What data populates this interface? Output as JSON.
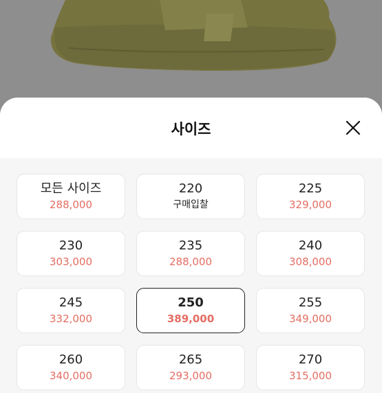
{
  "sheet": {
    "title": "사이즈"
  },
  "sizes": [
    {
      "label": "모든 사이즈",
      "price": "288,000"
    },
    {
      "label": "220",
      "price": "구매입찰"
    },
    {
      "label": "225",
      "price": "329,000"
    },
    {
      "label": "230",
      "price": "303,000"
    },
    {
      "label": "235",
      "price": "288,000"
    },
    {
      "label": "240",
      "price": "308,000"
    },
    {
      "label": "245",
      "price": "332,000"
    },
    {
      "label": "250",
      "price": "389,000"
    },
    {
      "label": "255",
      "price": "349,000"
    },
    {
      "label": "260",
      "price": "340,000"
    },
    {
      "label": "265",
      "price": "293,000"
    },
    {
      "label": "270",
      "price": "315,000"
    }
  ],
  "selected_size": "250",
  "colors": {
    "price": "#e46d62",
    "selected_border": "#222222"
  }
}
